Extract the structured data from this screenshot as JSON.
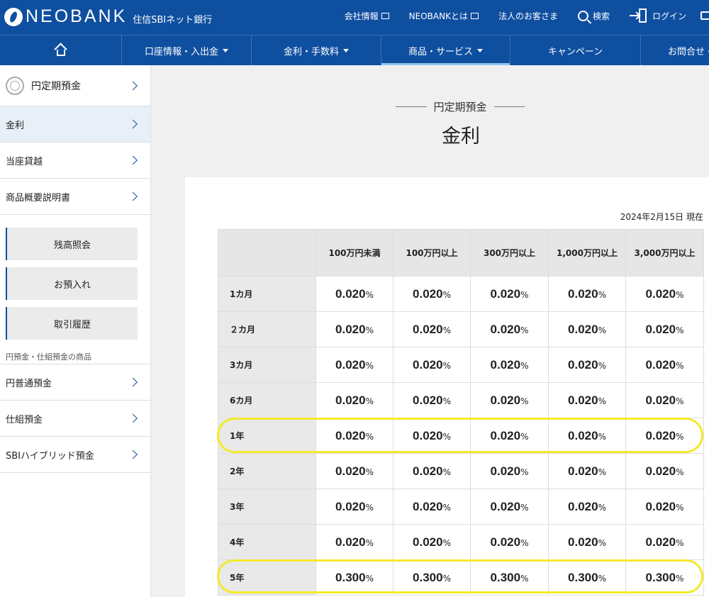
{
  "header": {
    "logo_text": "NEOBANK",
    "logo_sub": "住信SBIネット銀行",
    "top_links": [
      {
        "label": "会社情報",
        "icon": "window-icon"
      },
      {
        "label": "NEOBANKとは",
        "icon": "window-icon"
      },
      {
        "label": "法人のお客さま",
        "icon": ""
      },
      {
        "label": "検索",
        "icon": "search-icon"
      },
      {
        "label": "ログイン",
        "icon": "login-icon"
      }
    ],
    "nav": [
      {
        "label": "",
        "icon": "home-icon"
      },
      {
        "label": "口座情報・入出金",
        "dropdown": true
      },
      {
        "label": "金利・手数料",
        "dropdown": true
      },
      {
        "label": "商品・サービス",
        "dropdown": true,
        "active": true
      },
      {
        "label": "キャンペーン"
      },
      {
        "label": "お問合せ・"
      }
    ],
    "brand_color": "#0f4fa0"
  },
  "sidebar": {
    "top_item": "円定期預金",
    "items": [
      "金利",
      "当座貸越",
      "商品概要説明書"
    ],
    "active_item": "金利",
    "buttons": [
      "残高照会",
      "お預入れ",
      "取引履歴"
    ],
    "caption": "円預金・仕組預金の商品",
    "products": [
      "円普通預金",
      "仕組預金",
      "SBIハイブリッド預金"
    ]
  },
  "main": {
    "subtitle": "円定期預金",
    "title": "金利",
    "as_of": "2024年2月15日 現在",
    "table": {
      "columns": [
        "100万円未満",
        "100万円以上",
        "300万円以上",
        "1,000万円以上",
        "3,000万円以上"
      ],
      "unit": "%",
      "rows": [
        {
          "term": "1カ月",
          "rates": [
            "0.020",
            "0.020",
            "0.020",
            "0.020",
            "0.020"
          ]
        },
        {
          "term": "２カ月",
          "rates": [
            "0.020",
            "0.020",
            "0.020",
            "0.020",
            "0.020"
          ]
        },
        {
          "term": "3カ月",
          "rates": [
            "0.020",
            "0.020",
            "0.020",
            "0.020",
            "0.020"
          ]
        },
        {
          "term": "6カ月",
          "rates": [
            "0.020",
            "0.020",
            "0.020",
            "0.020",
            "0.020"
          ]
        },
        {
          "term": "1年",
          "rates": [
            "0.020",
            "0.020",
            "0.020",
            "0.020",
            "0.020"
          ],
          "highlighted": true
        },
        {
          "term": "2年",
          "rates": [
            "0.020",
            "0.020",
            "0.020",
            "0.020",
            "0.020"
          ]
        },
        {
          "term": "3年",
          "rates": [
            "0.020",
            "0.020",
            "0.020",
            "0.020",
            "0.020"
          ]
        },
        {
          "term": "4年",
          "rates": [
            "0.020",
            "0.020",
            "0.020",
            "0.020",
            "0.020"
          ]
        },
        {
          "term": "5年",
          "rates": [
            "0.300",
            "0.300",
            "0.300",
            "0.300",
            "0.300"
          ],
          "highlighted": true
        }
      ]
    },
    "highlight_color": "#f3ea2c"
  }
}
